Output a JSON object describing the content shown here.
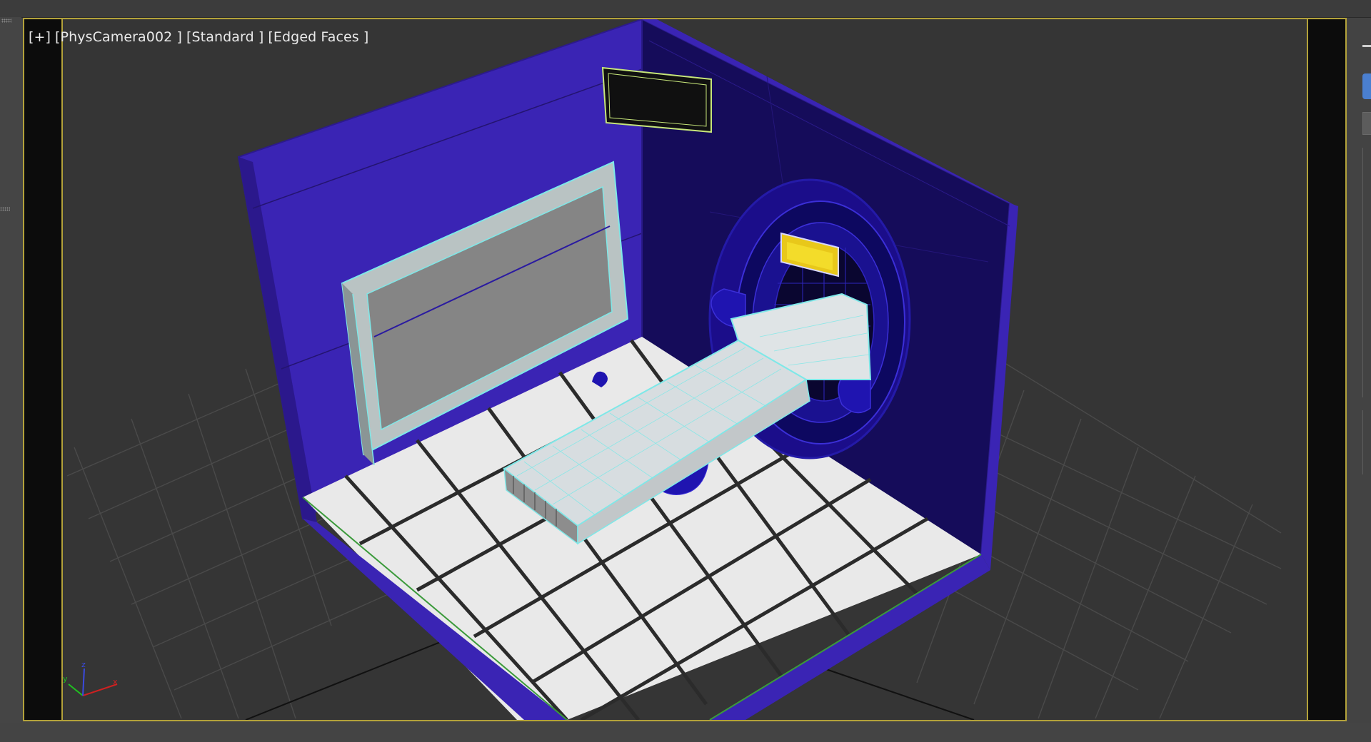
{
  "viewport": {
    "plus_menu": "[+]",
    "camera_menu": "[PhysCamera002 ]",
    "shading_menu": "[Standard ]",
    "display_menu": "[Edged Faces ]"
  },
  "axis_gizmo": {
    "x_label": "x",
    "y_label": "y",
    "z_label": "z"
  },
  "colors": {
    "viewport_border": "#b3a23a",
    "wall_color": "#3a24b4",
    "floor_tile": "#e9e9e9",
    "selection_wire": "#7ee8e8",
    "background": "#353535"
  }
}
